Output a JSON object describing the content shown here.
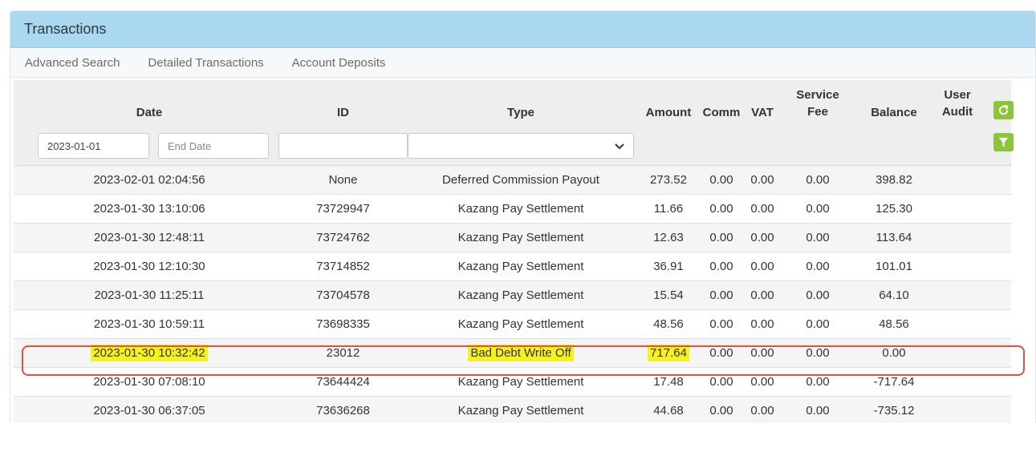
{
  "panel": {
    "title": "Transactions"
  },
  "tabs": [
    {
      "label": "Advanced Search"
    },
    {
      "label": "Detailed Transactions"
    },
    {
      "label": "Account Deposits"
    }
  ],
  "columns": {
    "date": "Date",
    "id": "ID",
    "type": "Type",
    "amount": "Amount",
    "comm": "Comm",
    "vat": "VAT",
    "service_fee_1": "Service",
    "service_fee_2": "Fee",
    "balance": "Balance",
    "user_audit_1": "User",
    "user_audit_2": "Audit"
  },
  "filters": {
    "start_date": "2023-01-01",
    "end_date_placeholder": "End Date",
    "id_value": "",
    "type_value": ""
  },
  "icons": {
    "refresh": "refresh-icon",
    "filter": "filter-icon",
    "accent": "#8cc43c",
    "highlight": "#f7f21e",
    "ring": "#e0533e"
  },
  "rows": [
    {
      "date": "2023-02-01 02:04:56",
      "id": "None",
      "type": "Deferred Commission Payout",
      "amount": "273.52",
      "comm": "0.00",
      "vat": "0.00",
      "fee": "0.00",
      "balance": "398.82"
    },
    {
      "date": "2023-01-30 13:10:06",
      "id": "73729947",
      "type": "Kazang Pay Settlement",
      "amount": "11.66",
      "comm": "0.00",
      "vat": "0.00",
      "fee": "0.00",
      "balance": "125.30"
    },
    {
      "date": "2023-01-30 12:48:11",
      "id": "73724762",
      "type": "Kazang Pay Settlement",
      "amount": "12.63",
      "comm": "0.00",
      "vat": "0.00",
      "fee": "0.00",
      "balance": "113.64"
    },
    {
      "date": "2023-01-30 12:10:30",
      "id": "73714852",
      "type": "Kazang Pay Settlement",
      "amount": "36.91",
      "comm": "0.00",
      "vat": "0.00",
      "fee": "0.00",
      "balance": "101.01"
    },
    {
      "date": "2023-01-30 11:25:11",
      "id": "73704578",
      "type": "Kazang Pay Settlement",
      "amount": "15.54",
      "comm": "0.00",
      "vat": "0.00",
      "fee": "0.00",
      "balance": "64.10"
    },
    {
      "date": "2023-01-30 10:59:11",
      "id": "73698335",
      "type": "Kazang Pay Settlement",
      "amount": "48.56",
      "comm": "0.00",
      "vat": "0.00",
      "fee": "0.00",
      "balance": "48.56"
    },
    {
      "date": "2023-01-30 10:32:42",
      "id": "23012",
      "type": "Bad Debt Write Off",
      "amount": "717.64",
      "comm": "0.00",
      "vat": "0.00",
      "fee": "0.00",
      "balance": "0.00",
      "highlighted": true
    },
    {
      "date": "2023-01-30 07:08:10",
      "id": "73644424",
      "type": "Kazang Pay Settlement",
      "amount": "17.48",
      "comm": "0.00",
      "vat": "0.00",
      "fee": "0.00",
      "balance": "-717.64"
    },
    {
      "date": "2023-01-30 06:37:05",
      "id": "73636268",
      "type": "Kazang Pay Settlement",
      "amount": "44.68",
      "comm": "0.00",
      "vat": "0.00",
      "fee": "0.00",
      "balance": "-735.12"
    }
  ]
}
